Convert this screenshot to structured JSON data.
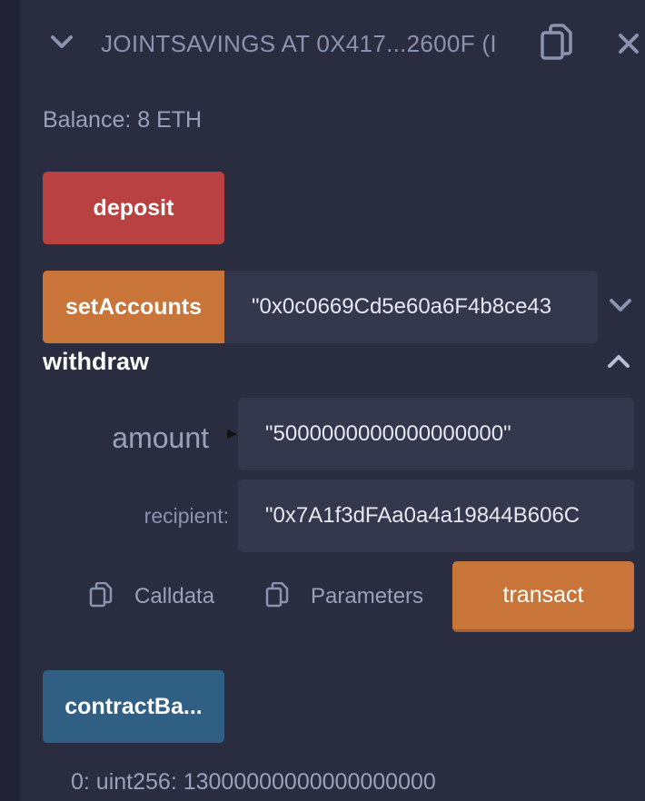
{
  "contract": {
    "title": "JOINTSAVINGS AT 0X417...2600F (I",
    "balance": "Balance: 8 ETH"
  },
  "functions": {
    "deposit": {
      "label": "deposit",
      "color": "#b94142"
    },
    "setAccounts": {
      "label": "setAccounts",
      "value": "\"0x0c0669Cd5e60a6F4b8ce43",
      "color": "#c97539"
    },
    "withdraw": {
      "title": "withdraw",
      "params": [
        {
          "label": "amount",
          "value": "\"5000000000000000000\""
        },
        {
          "label": "recipient:",
          "value": "\"0x7A1f3dFAa0a4a19844B606C"
        }
      ],
      "calldata_label": "Calldata",
      "parameters_label": "Parameters",
      "transact_label": "transact"
    },
    "contractBalance": {
      "label": "contractBa...",
      "color": "#2f5f83",
      "result": "0: uint256: 13000000000000000000"
    }
  },
  "icons": {
    "header_toggle": "chevron-down-icon",
    "header_copy": "copy-icon",
    "header_close": "close-icon",
    "setaccounts_expand": "chevron-down-icon",
    "withdraw_collapse": "chevron-up-icon",
    "calldata_copy": "copy-icon",
    "parameters_copy": "copy-icon"
  }
}
